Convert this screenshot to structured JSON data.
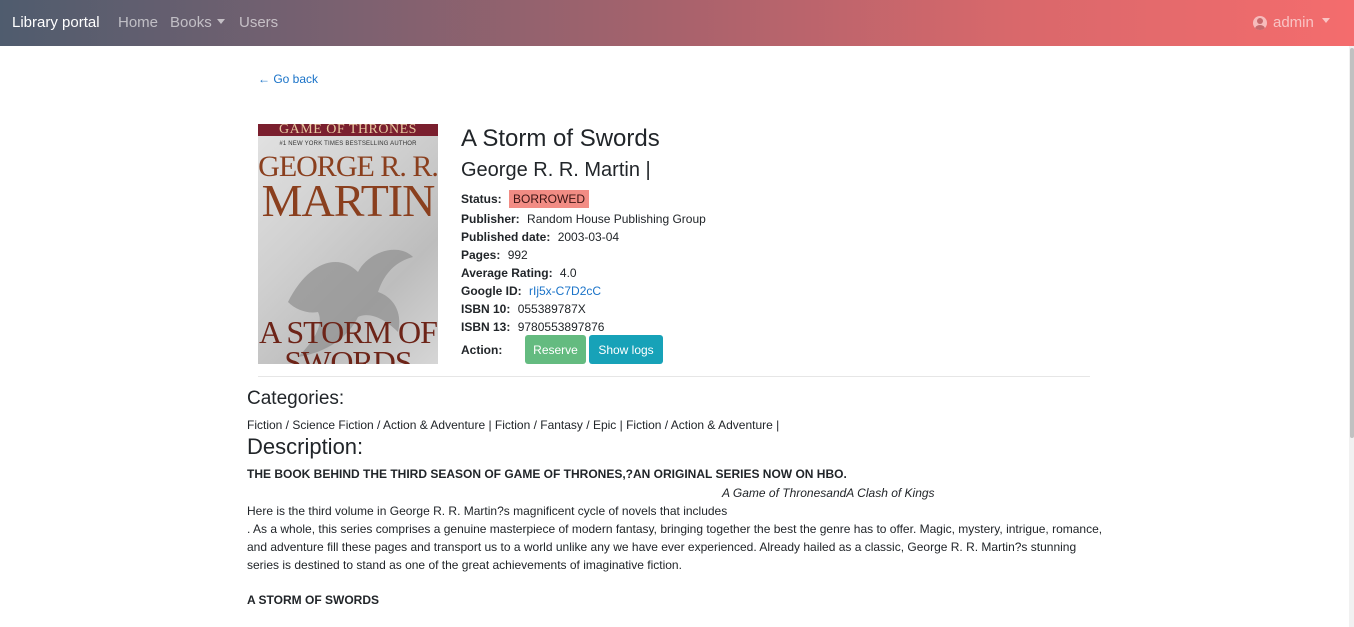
{
  "navbar": {
    "brand": "Library portal",
    "links": {
      "home": "Home",
      "books": "Books",
      "users": "Users"
    },
    "user": "admin"
  },
  "go_back": "← Go back",
  "cover": {
    "series": "GAME OF THRONES",
    "tagline": "#1 NEW YORK TIMES BESTSELLING AUTHOR",
    "author_line1": "GEORGE R. R.",
    "author_line2": "MARTIN",
    "title_line1": "A STORM OF",
    "title_line2": "SWORDS"
  },
  "book": {
    "title": "A Storm of Swords",
    "author": "George R. R. Martin |",
    "details": {
      "status_label": "Status:",
      "status_value": "BORROWED",
      "publisher_label": "Publisher:",
      "publisher_value": "Random House Publishing Group",
      "published_label": "Published date:",
      "published_value": "2003-03-04",
      "pages_label": "Pages:",
      "pages_value": "992",
      "rating_label": "Average Rating:",
      "rating_value": "4.0",
      "google_label": "Google ID:",
      "google_value": "rIj5x-C7D2cC",
      "isbn10_label": "ISBN 10:",
      "isbn10_value": "055389787X",
      "isbn13_label": "ISBN 13:",
      "isbn13_value": "9780553897876",
      "action_label": "Action:"
    },
    "actions": {
      "reserve": "Reserve",
      "show_logs": "Show logs"
    }
  },
  "categories": {
    "heading": "Categories:",
    "text": "Fiction / Science Fiction / Action & Adventure | Fiction / Fantasy / Epic | Fiction / Action & Adventure |"
  },
  "description": {
    "heading": "Description:",
    "headline": "THE BOOK BEHIND THE THIRD SEASON OF GAME OF THRONES,?AN ORIGINAL SERIES NOW ON HBO.",
    "italic_line": "A Game of ThronesandA Clash of Kings",
    "paragraph": "Here is the third volume in George R. R. Martin?s magnificent cycle of novels that includes\n. As a whole, this series comprises a genuine masterpiece of modern fantasy, bringing together the best the genre has to offer. Magic, mystery, intrigue, romance, and adventure fill these pages and transport us to a world unlike any we have ever experienced. Already hailed as a classic, George R. R. Martin?s stunning series is destined to stand as one of the great achievements of imaginative fiction.",
    "subheading": "A STORM OF SWORDS"
  },
  "colors": {
    "status_badge": "#f28c84",
    "reserve_button": "#5cb87a",
    "show_logs_button": "#17a2b8",
    "link": "#1a73c8"
  }
}
